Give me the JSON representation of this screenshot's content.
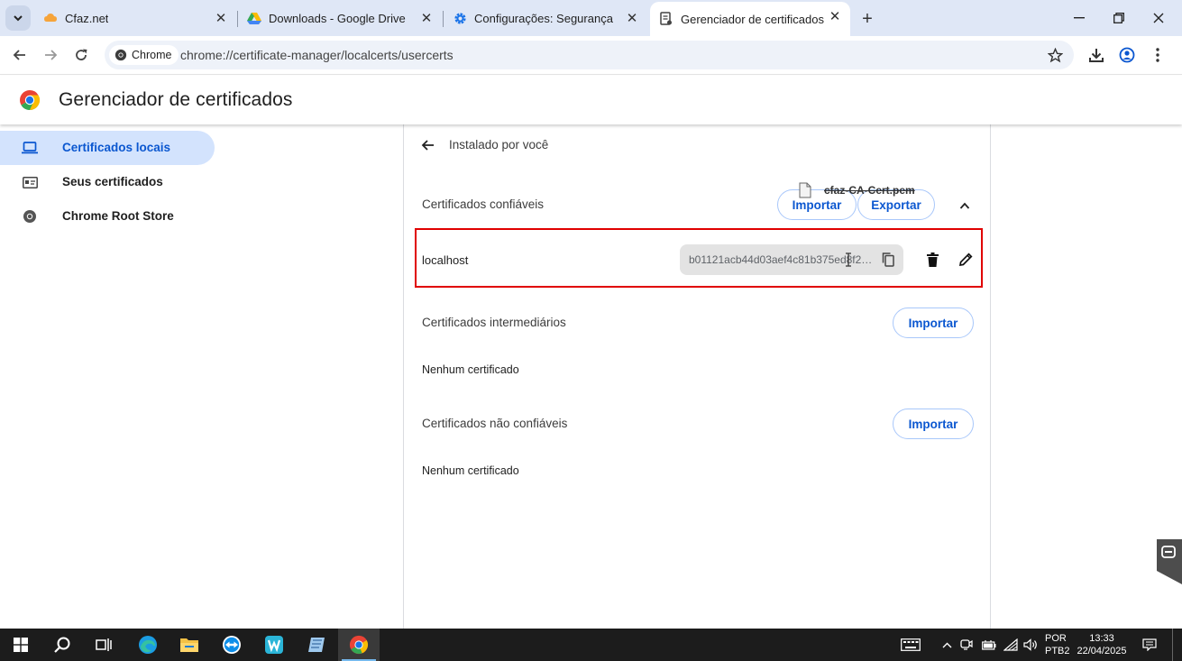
{
  "tabs": [
    {
      "title": "Cfaz.net",
      "favicon": "cloud-icon"
    },
    {
      "title": "Downloads - Google Drive",
      "favicon": "drive-icon"
    },
    {
      "title": "Configurações: Segurança",
      "favicon": "gear-icon"
    },
    {
      "title": "Gerenciador de certificados",
      "favicon": "certificate-icon",
      "active": true
    }
  ],
  "toolbar": {
    "chip_label": "Chrome",
    "url": "chrome://certificate-manager/localcerts/usercerts"
  },
  "page": {
    "title": "Gerenciador de certificados"
  },
  "sidebar": {
    "items": [
      {
        "label": "Certificados locais",
        "icon": "laptop-icon",
        "selected": true
      },
      {
        "label": "Seus certificados",
        "icon": "id-card-icon"
      },
      {
        "label": "Chrome Root Store",
        "icon": "chrome-icon"
      }
    ]
  },
  "main": {
    "subtitle": "Instalado por você",
    "trusted": {
      "label": "Certificados confiáveis",
      "import_label": "Importar",
      "export_label": "Exportar",
      "cert_name": "localhost",
      "hash": "b01121acb44d03aef4c81b375ed8f24c..."
    },
    "intermediate": {
      "label": "Certificados intermediários",
      "import_label": "Importar",
      "empty": "Nenhum certificado"
    },
    "untrusted": {
      "label": "Certificados não confiáveis",
      "import_label": "Importar",
      "empty": "Nenhum certificado"
    },
    "drag_file": "cfaz-CA-Cert.pem"
  },
  "taskbar": {
    "lang_primary": "POR",
    "lang_secondary": "PTB2",
    "time": "13:33",
    "date": "22/04/2025"
  },
  "colors": {
    "accent": "#0b57d0",
    "selected_bg": "#d3e3fd",
    "highlight_box": "#e00000",
    "tabstrip_bg": "#dfe7f6"
  }
}
